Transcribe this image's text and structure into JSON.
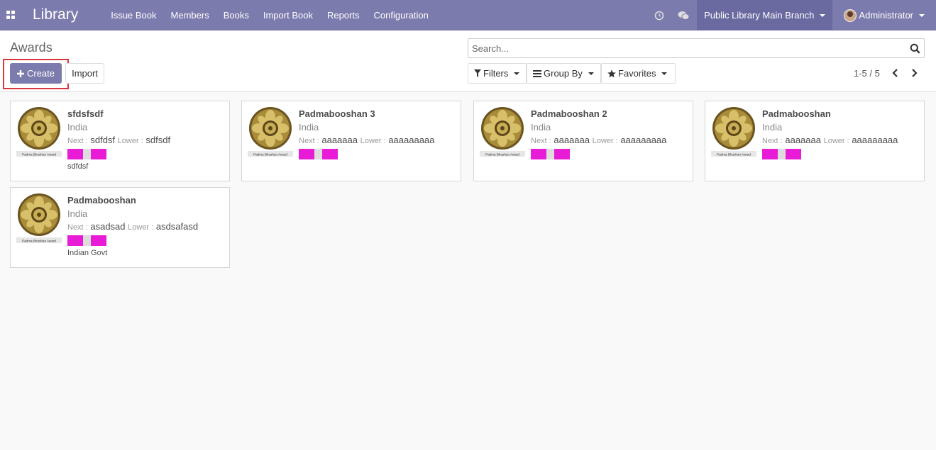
{
  "navbar": {
    "brand": "Library",
    "menu": [
      "Issue Book",
      "Members",
      "Books",
      "Import Book",
      "Reports",
      "Configuration"
    ],
    "branch": "Public Library Main Branch",
    "user": "Administrator"
  },
  "control_panel": {
    "breadcrumb": "Awards",
    "create_label": "Create",
    "import_label": "Import",
    "search_placeholder": "Search...",
    "filters_label": "Filters",
    "groupby_label": "Group By",
    "favorites_label": "Favorites",
    "pager": "1-5 / 5"
  },
  "cards": [
    {
      "title": "sfdsfsdf",
      "country": "India",
      "next_label": "Next :",
      "next": "sdfdsf",
      "lower_label": "Lower :",
      "lower": "sdfsdf",
      "note": "sdfdsf",
      "image_caption": "Padma Bhushan Award"
    },
    {
      "title": "Padmabooshan 3",
      "country": "India",
      "next_label": "Next :",
      "next": "aaaaaaa",
      "lower_label": "Lower :",
      "lower": "aaaaaaaaa",
      "note": "",
      "image_caption": "Padma Bhushan Award"
    },
    {
      "title": "Padmabooshan 2",
      "country": "India",
      "next_label": "Next :",
      "next": "aaaaaaa",
      "lower_label": "Lower :",
      "lower": "aaaaaaaaa",
      "note": "",
      "image_caption": "Padma Bhushan Award"
    },
    {
      "title": "Padmabooshan",
      "country": "India",
      "next_label": "Next :",
      "next": "aaaaaaa",
      "lower_label": "Lower :",
      "lower": "aaaaaaaaa",
      "note": "",
      "image_caption": "Padma Bhushan Award"
    },
    {
      "title": "Padmabooshan",
      "country": "India",
      "next_label": "Next :",
      "next": "asadsad",
      "lower_label": "Lower :",
      "lower": "asdsafasd",
      "note": "Indian Govt",
      "image_caption": "Padma Bhushan Award"
    }
  ],
  "colors": {
    "navbar": "#7c7bad",
    "swatch": "#e81bd6",
    "highlight": "#d9363e"
  }
}
